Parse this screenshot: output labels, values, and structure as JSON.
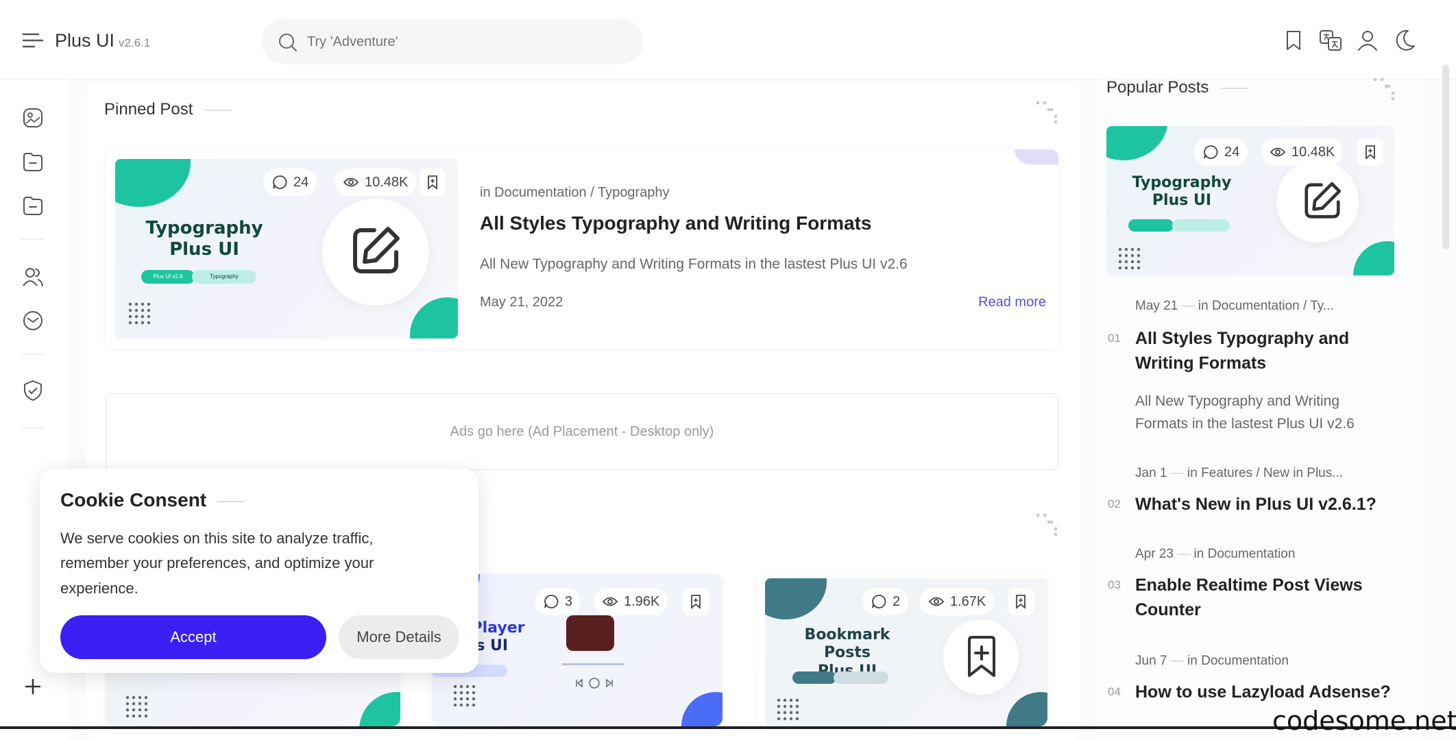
{
  "header": {
    "brand": "Plus UI",
    "version": "v2.6.1",
    "search_placeholder": "Try 'Adventure'"
  },
  "pinned": {
    "section_title": "Pinned Post",
    "comments": "24",
    "views": "10.48K",
    "thumb_title_line1": "Typography",
    "thumb_title_line2": "Plus UI",
    "pill1": "Plus UI v2.6",
    "pill2": "Typography",
    "category": "in Documentation / Typography",
    "title": "All Styles Typography and Writing Formats",
    "excerpt": "All New Typography and Writing Formats in the lastest Plus UI v2.6",
    "date": "May 21, 2022",
    "read_more": "Read more"
  },
  "ad": {
    "text": "Ads go here (Ad Placement - Desktop only)"
  },
  "grid_cards": [
    {
      "comments": "3",
      "views": "1.96K",
      "thumb_line1": "usic Player",
      "thumb_line2": "Plus UI"
    },
    {
      "comments": "2",
      "views": "1.67K",
      "thumb_line1": "Bookmark Posts",
      "thumb_line2": "Plus UI"
    }
  ],
  "popular": {
    "section_title": "Popular Posts",
    "thumb": {
      "comments": "24",
      "views": "10.48K",
      "line1": "Typography",
      "line2": "Plus UI"
    },
    "items": [
      {
        "num": "01",
        "date": "May 21",
        "category": "in Documentation / Ty...",
        "title_line1": "All Styles Typography and",
        "title_line2": "Writing Formats",
        "excerpt_line1": "All New Typography and Writing",
        "excerpt_line2": "Formats in the lastest Plus UI v2.6"
      },
      {
        "num": "02",
        "date": "Jan 1",
        "category": "in Features / New in Plus...",
        "title_line1": "What's New in Plus UI v2.6.1?"
      },
      {
        "num": "03",
        "date": "Apr 23",
        "category": "in Documentation",
        "title_line1": "Enable Realtime Post Views",
        "title_line2": "Counter"
      },
      {
        "num": "04",
        "date": "Jun 7",
        "category": "in Documentation",
        "title_line1": "How to use Lazyload Adsense?"
      }
    ]
  },
  "cookie": {
    "title": "Cookie Consent",
    "text": "We serve cookies on this site to analyze traffic, remember your preferences, and optimize your experience.",
    "accept": "Accept",
    "more": "More Details"
  },
  "watermark": "codesome.net",
  "colors": {
    "accent": "#3b1ff5",
    "teal": "#1ec4a0",
    "link": "#5b4ce0"
  }
}
